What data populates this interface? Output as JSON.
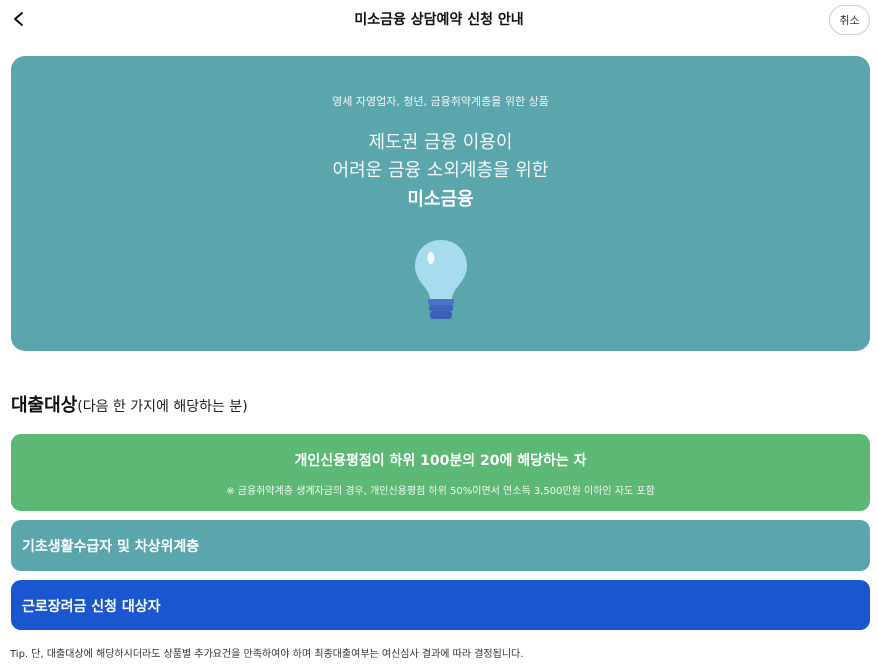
{
  "header": {
    "title": "미소금융 상담예약 신청 안내",
    "cancel_label": "취소",
    "back_icon": "chevron-left-icon"
  },
  "hero": {
    "subtitle": "영세 자영업자, 청년, 금융취약계층을 위한 상품",
    "line1": "제도권 금융 이용이",
    "line2": "어려운 금융 소외계층을 위한",
    "line3": "미소금융",
    "icon": "lightbulb-icon",
    "background": "#5ba5ad"
  },
  "section": {
    "title": "대출대상",
    "title_paren": "(다음 한 가지에 해당하는 분)"
  },
  "targets": {
    "credit": {
      "label": "개인신용평점이 하위 100분의 20에 해당하는 자",
      "note": "※ 금융취약계층 생계자금의 경우, 개인신용평점 하위 50%이면서 연소득 3,500만원 이하인 자도 포함",
      "color": "#5cb874"
    },
    "basic_living": {
      "label": "기초생활수급자 및 차상위계층",
      "color": "#5ba5ad"
    },
    "work_incentive": {
      "label": "근로장려금 신청 대상자",
      "color": "#1a56cf"
    }
  },
  "tip": "Tip. 단, 대출대상에 해당하시더라도 상품별 추가요건을 만족하여야 하며 최종대출여부는 여신심사 결과에 따라 결정됩니다."
}
